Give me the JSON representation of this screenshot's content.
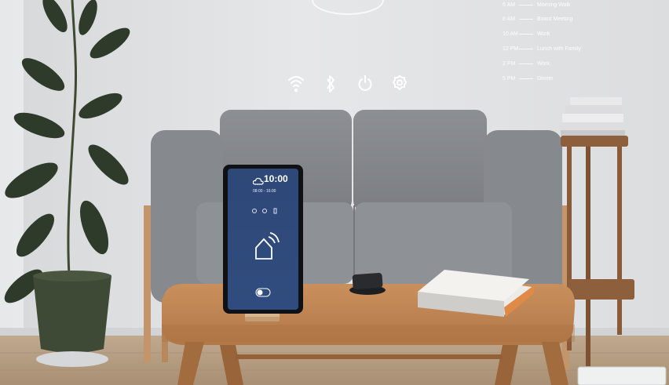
{
  "overlay": {
    "colors": {
      "overlay": "#ffffff",
      "device_screen": "#2f4a7a",
      "wall": "#e2e3e5"
    },
    "quick_icons": [
      "wifi-icon",
      "bluetooth-icon",
      "power-icon",
      "settings-icon"
    ],
    "schedule": [
      {
        "time": "6 AM",
        "event": "Morning Walk"
      },
      {
        "time": "8 AM",
        "event": "Board Meeting"
      },
      {
        "time": "10 AM",
        "event": "Work"
      },
      {
        "time": "12 PM",
        "event": "Lunch with Family"
      },
      {
        "time": "2 PM",
        "event": "Work"
      },
      {
        "time": "5 PM",
        "event": "Dinner"
      }
    ]
  },
  "device": {
    "clock": "10:00",
    "weather_icon": "cloud-icon",
    "temp_range": "08:00 - 16:00",
    "center_icon": "smart-home-icon",
    "toggle_icon": "toggle-icon"
  }
}
